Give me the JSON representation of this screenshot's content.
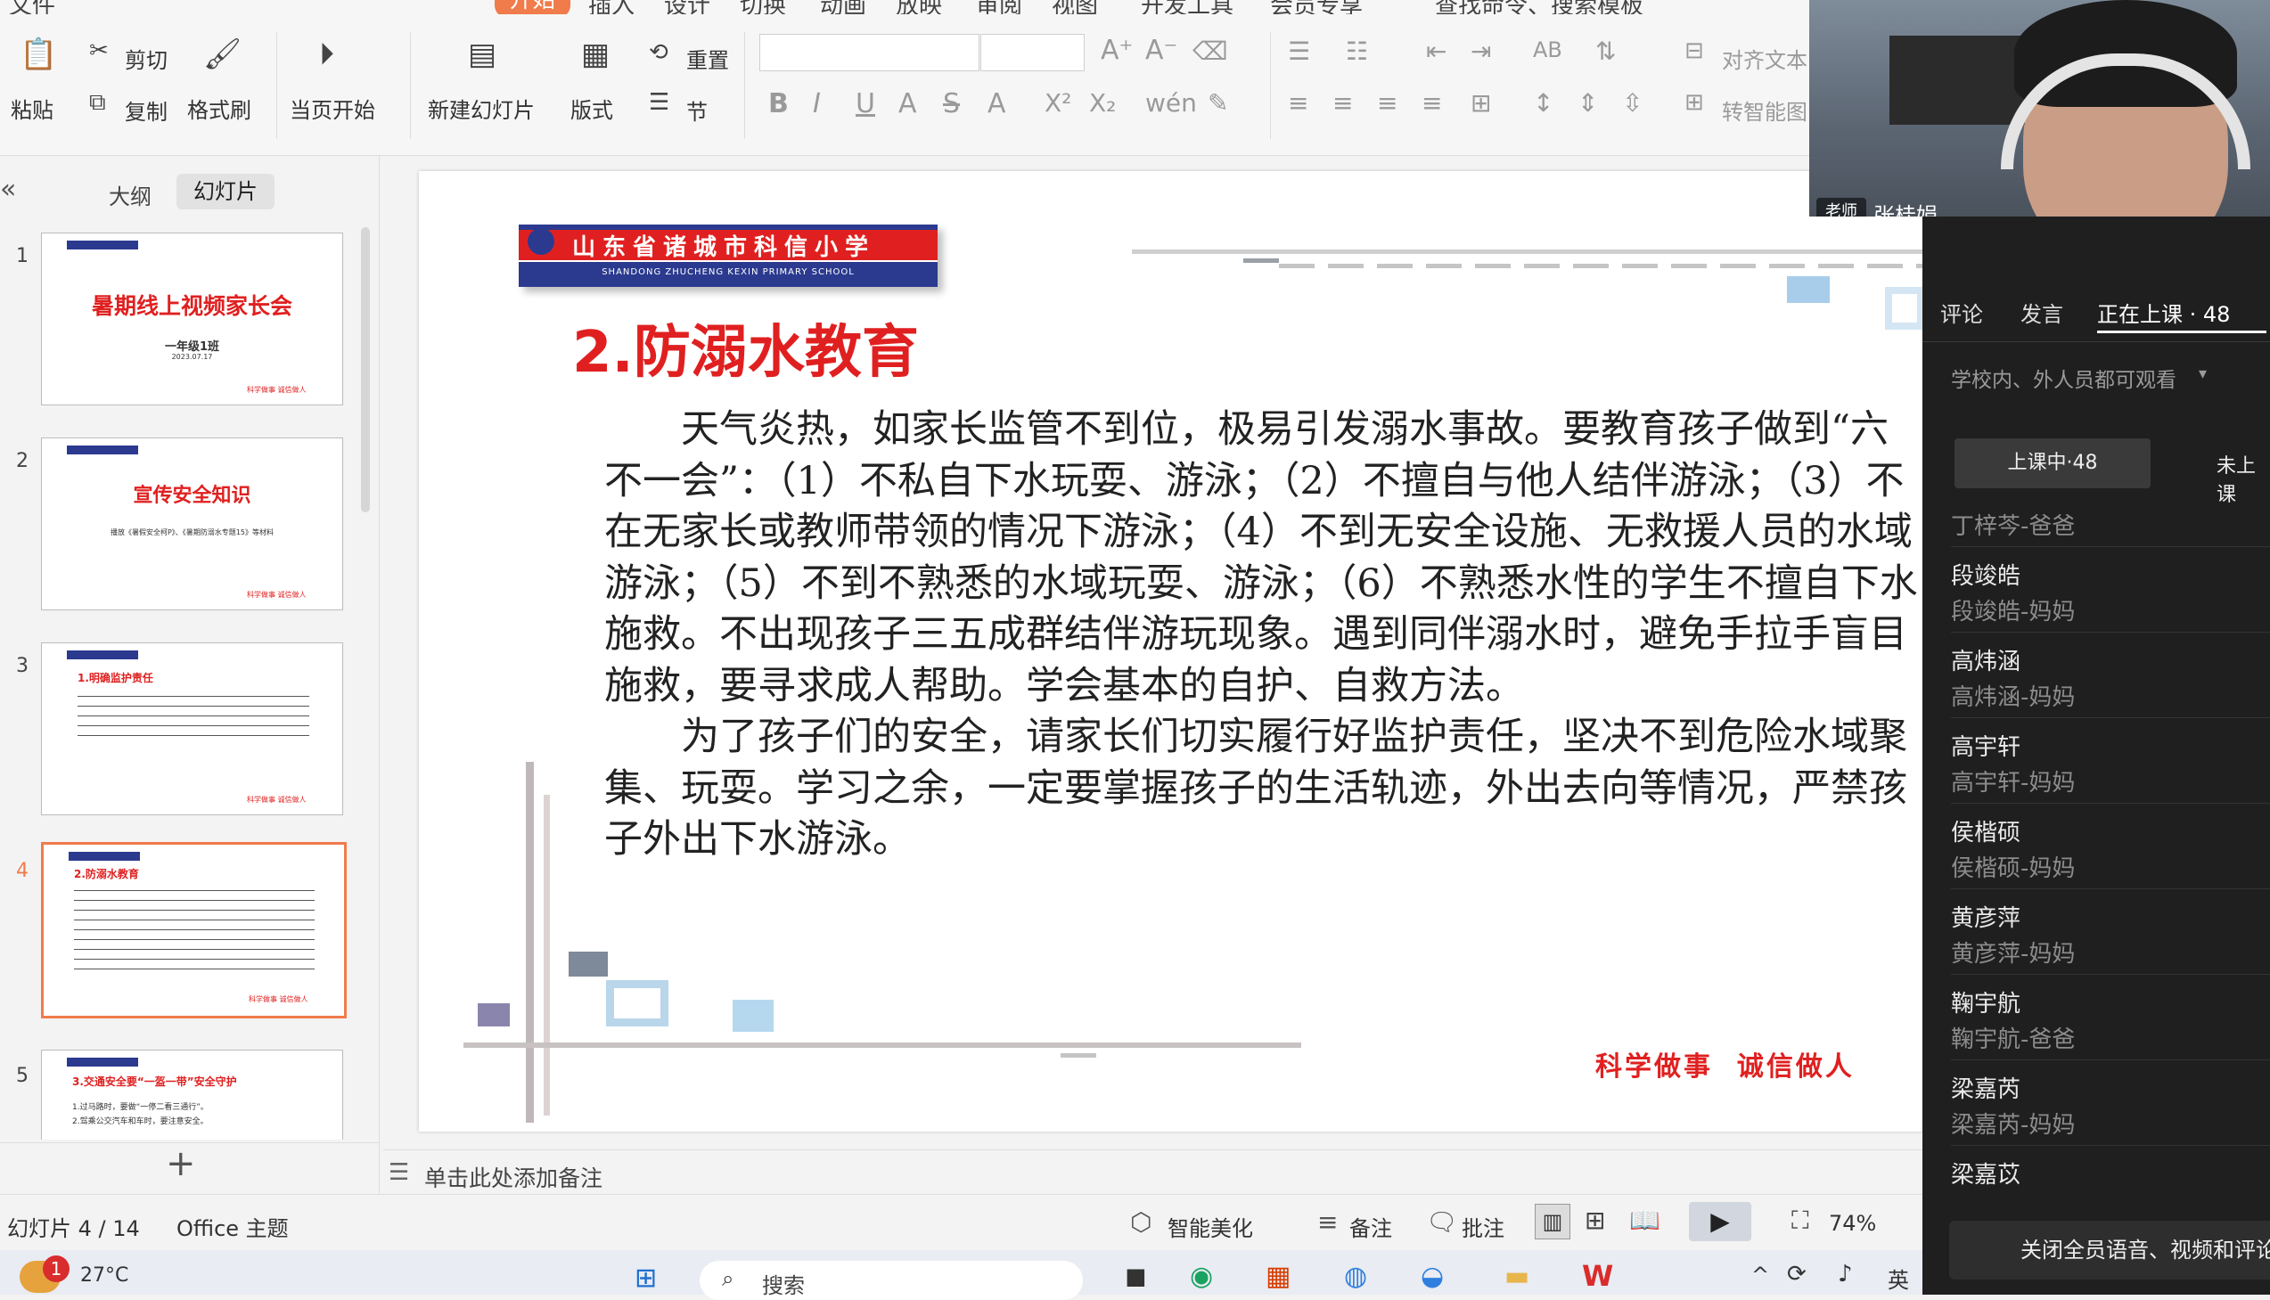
{
  "menu": {
    "items": [
      "文件",
      "开始",
      "插入",
      "设计",
      "切换",
      "动画",
      "放映",
      "审阅",
      "视图",
      "开发工具",
      "会员专享",
      "查找命令、搜索模板"
    ]
  },
  "ribbon": {
    "paste": "粘贴",
    "cut": "剪切",
    "copy": "复制",
    "format_painter": "格式刷",
    "play_from_current": "当页开始",
    "new_slide": "新建幻灯片",
    "layout": "版式",
    "reset": "重置",
    "section": "节",
    "align_text": "对齐文本",
    "to_smartart": "转智能图"
  },
  "left_pane": {
    "tabs": [
      "大纲",
      "幻灯片"
    ],
    "add_slide": "+",
    "thumbnails": [
      {
        "num": "1",
        "title": "暑期线上视频家长会",
        "sub1": "一年级1班",
        "sub2": "2023.07.17",
        "footer": "科学做事  诚信做人"
      },
      {
        "num": "2",
        "title": "宣传安全知识",
        "sub1": "播放《暑假安全柯P》、《暑期防溺水专题15》等材料",
        "footer": "科学做事  诚信做人"
      },
      {
        "num": "3",
        "title": "1.明确监护责任",
        "footer": "科学做事  诚信做人"
      },
      {
        "num": "4",
        "title": "2.防溺水教育",
        "footer": "科学做事  诚信做人"
      },
      {
        "num": "5",
        "title": "3.交通安全要“一盔一带”安全守护",
        "sub1": "1.过马路时，要做“一停二看三通行”。",
        "sub2": "2.驾乘公交汽车和车时，要注意安全。"
      }
    ]
  },
  "slide": {
    "school_name": "山东省诸城市科信小学",
    "school_name_en": "SHANDONG ZHUCHENG KEXIN PRIMARY SCHOOL",
    "heading": "2.防溺水教育",
    "para1": "天气炎热，如家长监管不到位，极易引发溺水事故。要教育孩子做到“六不一会”：（1）不私自下水玩耍、游泳；（2）不擅自与他人结伴游泳；（3）不在无家长或教师带领的情况下游泳；（4）不到无安全设施、无救援人员的水域游泳；（5）不到不熟悉的水域玩耍、游泳；（6）不熟悉水性的学生不擅自下水施救。不出现孩子三五成群结伴游玩现象。遇到同伴溺水时，避免手拉手盲目施救，要寻求成人帮助。学会基本的自护、自救方法。",
    "para2": "为了孩子们的安全，请家长们切实履行好监护责任，坚决不到危险水域聚集、玩耍。学习之余，一定要掌握孩子的生活轨迹，外出去向等情况，严禁孩子外出下水游泳。",
    "motto": "科学做事  诚信做人"
  },
  "notes_placeholder": "单击此处添加备注",
  "status": {
    "slide_counter": "幻灯片 4 / 14",
    "theme": "Office 主题",
    "beautify": "智能美化",
    "notes": "备注",
    "comment": "批注",
    "zoom": "74%"
  },
  "video": {
    "role": "老师",
    "name": "张桂娟"
  },
  "live_panel": {
    "tabs": [
      "评论",
      "发言",
      "正在上课 · 48"
    ],
    "visibility": "学校内、外人员都可观看",
    "sub_tabs": [
      "上课中·48",
      "未上课"
    ],
    "participants": [
      {
        "name": "",
        "role": "丁梓芩-爸爸"
      },
      {
        "name": "段竣皓",
        "role": "段竣皓-妈妈"
      },
      {
        "name": "高炜涵",
        "role": "高炜涵-妈妈"
      },
      {
        "name": "高宇轩",
        "role": "高宇轩-妈妈"
      },
      {
        "name": "侯楷硕",
        "role": "侯楷硕-妈妈"
      },
      {
        "name": "黄彦萍",
        "role": "黄彦萍-妈妈"
      },
      {
        "name": "鞠宇航",
        "role": "鞠宇航-爸爸"
      },
      {
        "name": "梁嘉芮",
        "role": "梁嘉芮-妈妈"
      },
      {
        "name": "梁嘉苡",
        "role": ""
      }
    ],
    "close_all_button": "关闭全员语音、视频和评论"
  },
  "taskbar": {
    "weather": "27°C",
    "badge": "1",
    "search": "搜索",
    "lang": "英"
  },
  "colors": {
    "accent_red": "#e02020",
    "selected_orange": "#f07b4b",
    "panel_bg": "#1f1f1f"
  }
}
